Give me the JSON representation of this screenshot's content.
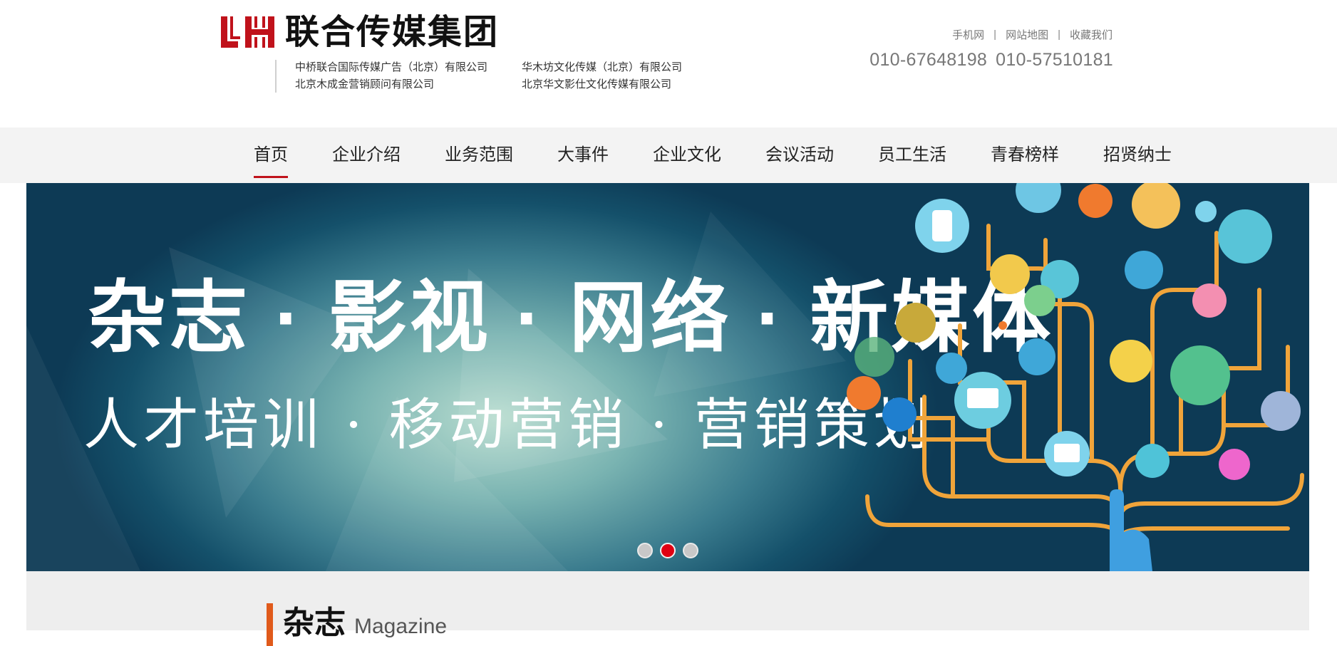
{
  "logo": {
    "mark": "LH",
    "name": "联合传媒集团"
  },
  "companies": [
    "中桥联合国际传媒广告（北京）有限公司",
    "华木坊文化传媒（北京）有限公司",
    "北京木成金营销顾问有限公司",
    "北京华文影仕文化传媒有限公司"
  ],
  "top_links": [
    "手机网",
    "网站地图",
    "收藏我们"
  ],
  "top_link_separator": "|",
  "phones": [
    "010-67648198",
    "010-57510181"
  ],
  "nav": {
    "items": [
      "首页",
      "企业介绍",
      "业务范围",
      "大事件",
      "企业文化",
      "会议活动",
      "员工生活",
      "青春榜样",
      "招贤纳士"
    ],
    "active_index": 0
  },
  "banner": {
    "line1": "杂志 · 影视 · 网络 · 新媒体",
    "line2": "人才培训 · 移动营销 · 营销策划",
    "slide_count": 3,
    "active_slide": 1
  },
  "section": {
    "title": "杂志",
    "subtitle": "Magazine"
  },
  "colors": {
    "brand_red": "#c0121b",
    "accent_orange": "#e05a1b",
    "nav_bg": "#f3f3f3"
  }
}
